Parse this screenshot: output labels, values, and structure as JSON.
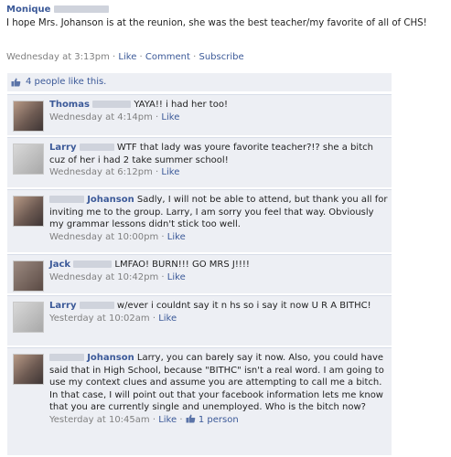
{
  "post": {
    "author": "Monique",
    "text": "I hope Mrs. Johanson is at the reunion, she was the best teacher/my favorite of all of CHS!",
    "time": "Wednesday at 3:13pm",
    "actions": [
      "Like",
      "Comment",
      "Subscribe"
    ],
    "separator": "·",
    "likes": "4 people like this."
  },
  "comments": [
    {
      "name": "Thomas",
      "text": "YAYA!! i had her too!",
      "time": "Wednesday at 4:14pm",
      "like": "Like"
    },
    {
      "name": "Larry",
      "text": "WTF that lady was youre favorite teacher?!? she a bitch cuz of her i had 2 take summer school!",
      "time": "Wednesday at 6:12pm",
      "like": "Like"
    },
    {
      "name": "Johanson",
      "text": "Sadly, I will not be able to attend, but thank you all for inviting me to the group. Larry, I am sorry you feel that way. Obviously my grammar lessons didn't stick too well.",
      "time": "Wednesday at 10:00pm",
      "like": "Like"
    },
    {
      "name": "Jack",
      "text": "LMFAO! BURN!!! GO MRS J!!!!",
      "time": "Wednesday at 10:42pm",
      "like": "Like"
    },
    {
      "name": "Larry",
      "text": "w/ever i couldnt say it n hs so i say it now U R A BITHC!",
      "time": "Yesterday at 10:02am",
      "like": "Like"
    },
    {
      "name": "Johanson",
      "text": "Larry, you can barely say it now. Also, you could have said that in High School, because \"BITHC\" isn't a real word. I am going to use my context clues and assume you are attempting to call me a bitch. In that case, I will point out that your facebook information lets me know that you are currently single and unemployed. Who is the bitch now?",
      "time": "Yesterday at 10:45am",
      "like": "Like",
      "like_count": "1 person"
    }
  ]
}
